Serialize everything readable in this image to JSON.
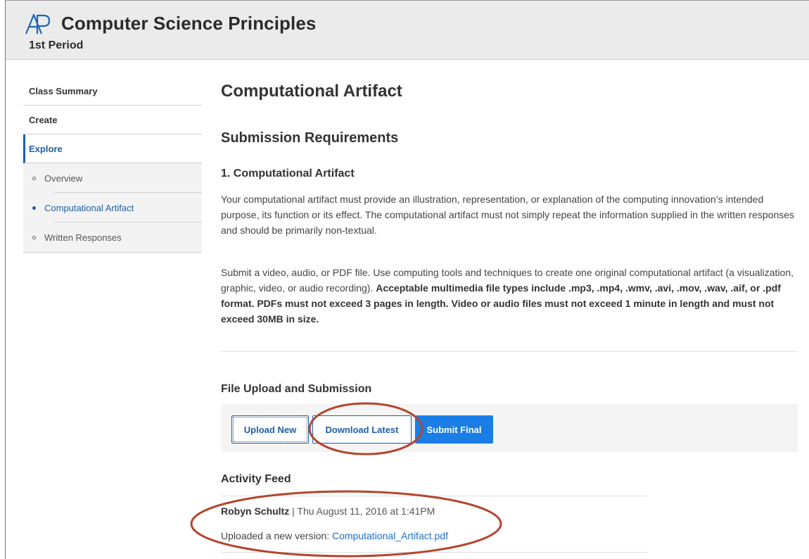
{
  "header": {
    "logo_text": "AP",
    "title": "Computer Science Principles",
    "subtitle": "1st Period"
  },
  "sidebar": {
    "items": [
      {
        "label": "Class Summary"
      },
      {
        "label": "Create"
      },
      {
        "label": "Explore"
      }
    ],
    "sub_items": [
      {
        "label": "Overview"
      },
      {
        "label": "Computational Artifact"
      },
      {
        "label": "Written Responses"
      }
    ]
  },
  "main": {
    "page_title": "Computational Artifact",
    "section_title": "Submission Requirements",
    "requirement_title": "1. Computational Artifact",
    "para1": "Your computational artifact must provide an illustration, representation, or explanation of the computing innovation’s intended purpose, its function or its effect. The computational artifact must not simply repeat the information supplied in the written responses and should be primarily non-textual.",
    "para2_plain": "Submit a video, audio, or PDF file. Use computing tools and techniques to create one original computational artifact (a visualization, graphic, video, or audio recording).",
    "para2_bold": "Acceptable multimedia file types include .mp3, .mp4, .wmv, .avi, .mov, .wav, .aif, or .pdf format. PDFs must not exceed 3 pages in length. Video or audio files must not exceed 1 minute in length and must not exceed 30MB in size.",
    "upload_title": "File Upload and Submission",
    "buttons": {
      "upload": "Upload New",
      "download": "Download Latest",
      "submit": "Submit Final"
    },
    "feed": {
      "title": "Activity Feed",
      "author": "Robyn Schultz",
      "separator": " | ",
      "timestamp": "Thu August 11, 2016 at 1:41PM",
      "action_text": "Uploaded a new version: ",
      "file_link": "Computational_Artifact.pdf"
    }
  },
  "colors": {
    "accent": "#1f5fa8",
    "primary_button": "#1a7ee6",
    "annotation": "#b5442e",
    "header_bg": "#ebebeb"
  }
}
